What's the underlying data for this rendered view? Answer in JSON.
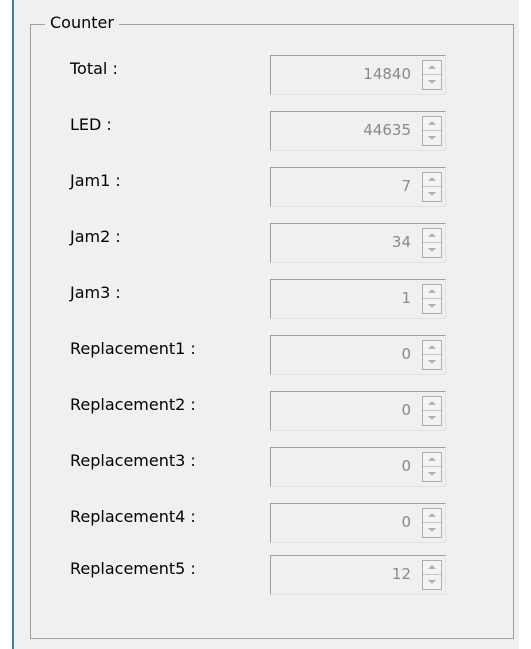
{
  "group": {
    "legend": "Counter"
  },
  "counters": [
    {
      "label": "Total :",
      "value": "14840"
    },
    {
      "label": "LED :",
      "value": "44635"
    },
    {
      "label": "Jam1 :",
      "value": "7"
    },
    {
      "label": "Jam2 :",
      "value": "34"
    },
    {
      "label": "Jam3 :",
      "value": "1"
    },
    {
      "label": "Replacement1 :",
      "value": "0"
    },
    {
      "label": "Replacement2 :",
      "value": "0"
    },
    {
      "label": "Replacement3 :",
      "value": "0"
    },
    {
      "label": "Replacement4 :",
      "value": "0"
    },
    {
      "label": "Replacement5 :",
      "value": "12"
    }
  ],
  "colors": {
    "panel_background": "#f0f0f0",
    "window_border": "#3c7fb1",
    "disabled_text": "#8a8a8a"
  },
  "state": {
    "spinners_enabled": false
  }
}
